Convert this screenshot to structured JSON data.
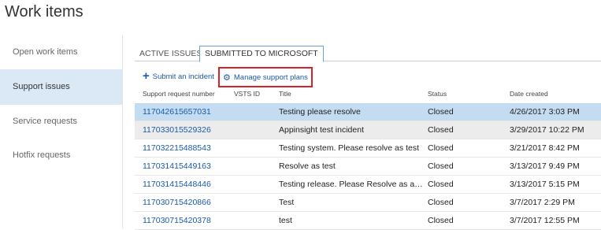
{
  "page": {
    "title": "Work items"
  },
  "sidebar": {
    "items": [
      {
        "label": "Open work items"
      },
      {
        "label": "Support issues"
      },
      {
        "label": "Service requests"
      },
      {
        "label": "Hotfix requests"
      }
    ]
  },
  "tabs": [
    {
      "label": "ACTIVE ISSUES"
    },
    {
      "label": "SUBMITTED TO MICROSOFT"
    }
  ],
  "toolbar": {
    "submit_label": "Submit an incident",
    "manage_label": "Manage support plans",
    "submit_icon": "plus-icon",
    "manage_icon": "gear-icon"
  },
  "table": {
    "columns": [
      "Support request number",
      "VSTS ID",
      "Title",
      "Status",
      "Date created"
    ],
    "rows": [
      {
        "number": "117042615657031",
        "vsts": "",
        "title": "Testing please resolve",
        "status": "Closed",
        "date": "4/26/2017 3:03 PM"
      },
      {
        "number": "117033015529326",
        "vsts": "",
        "title": "Appinsight test incident",
        "status": "Closed",
        "date": "3/29/2017 10:22 PM"
      },
      {
        "number": "117032215488543",
        "vsts": "",
        "title": "Testing system. Please resolve as test",
        "status": "Closed",
        "date": "3/21/2017 8:42 PM"
      },
      {
        "number": "117031415449163",
        "vsts": "",
        "title": "Resolve as test",
        "status": "Closed",
        "date": "3/13/2017 9:49 PM"
      },
      {
        "number": "117031415448446",
        "vsts": "",
        "title": "Testing release. Please Resolve as a te...",
        "status": "Closed",
        "date": "3/13/2017 5:15 PM"
      },
      {
        "number": "117030715420866",
        "vsts": "",
        "title": "Test",
        "status": "Closed",
        "date": "3/7/2017 2:29 PM"
      },
      {
        "number": "117030715420378",
        "vsts": "",
        "title": "test",
        "status": "Closed",
        "date": "3/7/2017 12:55 PM"
      }
    ]
  },
  "colors": {
    "accent": "#1a5aa8",
    "selected_row": "#c4dcf2",
    "hover_row": "#ececec",
    "highlight_border": "#d9212a",
    "sidebar_active": "#dbe9f7"
  }
}
